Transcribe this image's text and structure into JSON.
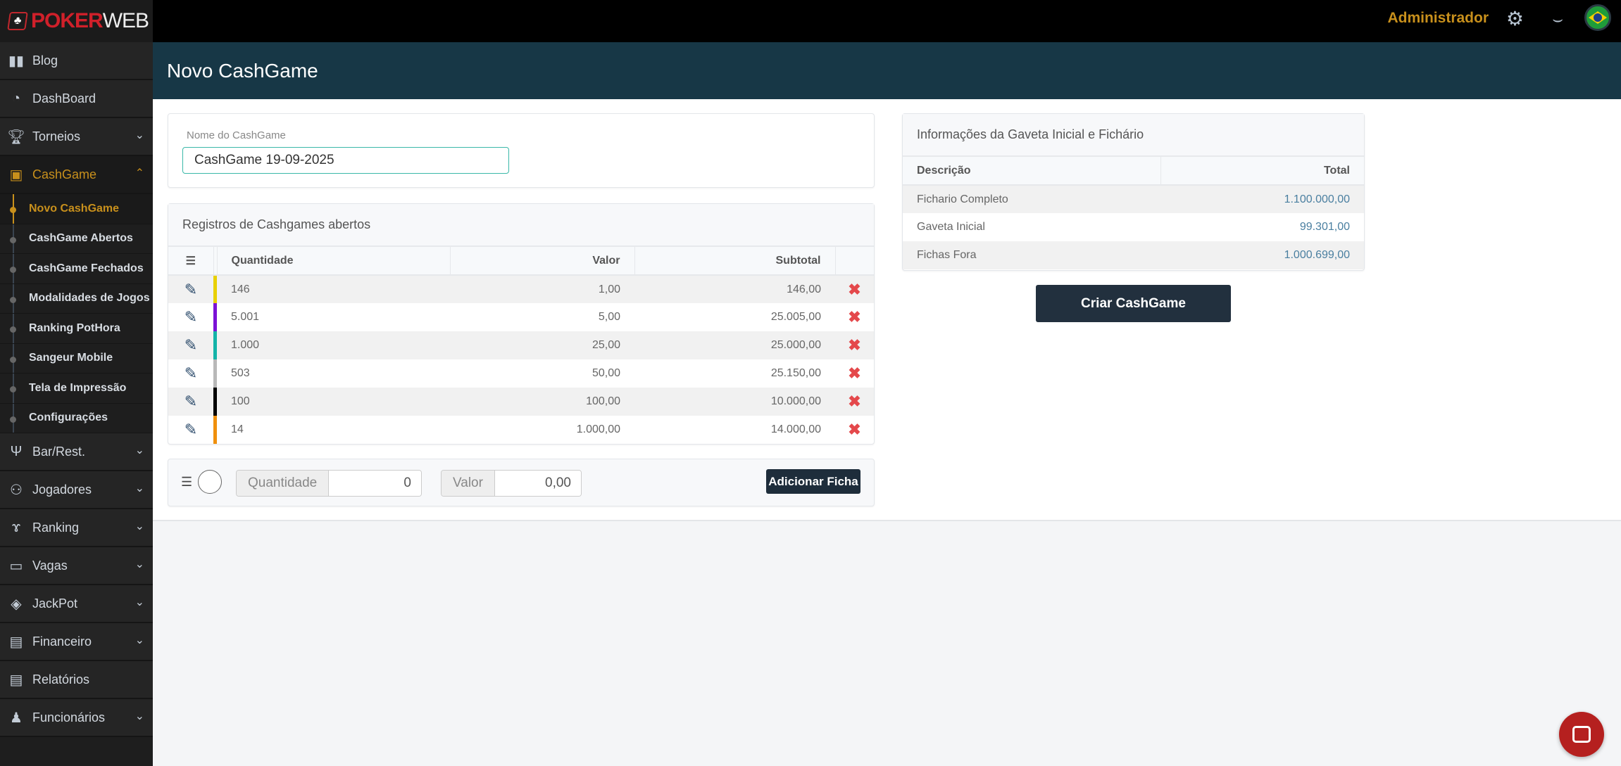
{
  "brand": {
    "text_red": "POKER",
    "text_white": "WEB"
  },
  "topbar": {
    "user": "Administrador",
    "icons": [
      "gears-icon",
      "mustache-icon",
      "brazil-flag-icon"
    ]
  },
  "sidebar": {
    "items": [
      {
        "label": "Blog",
        "icon": "book-icon"
      },
      {
        "label": "DashBoard",
        "icon": "pie-chart-icon"
      },
      {
        "label": "Torneios",
        "icon": "trophy-icon"
      },
      {
        "label": "CashGame",
        "icon": "money-icon"
      }
    ],
    "cashgame_sub": [
      "Novo CashGame",
      "CashGame Abertos",
      "CashGame Fechados",
      "Modalidades de Jogos",
      "Ranking PotHora",
      "Sangeur Mobile",
      "Tela de Impressão",
      "Configurações"
    ],
    "items2": [
      {
        "label": "Bar/Rest.",
        "icon": "utensils-icon"
      },
      {
        "label": "Jogadores",
        "icon": "users-icon"
      },
      {
        "label": "Ranking",
        "icon": "medal-icon"
      },
      {
        "label": "Vagas",
        "icon": "ticket-icon"
      },
      {
        "label": "JackPot",
        "icon": "gem-icon"
      },
      {
        "label": "Financeiro",
        "icon": "invoice-icon"
      },
      {
        "label": "Relatórios",
        "icon": "file-icon"
      },
      {
        "label": "Funcionários",
        "icon": "user-lock-icon"
      }
    ]
  },
  "page": {
    "title": "Novo CashGame"
  },
  "form": {
    "name_label": "Nome do CashGame",
    "name_value": "CashGame 19-09-2025"
  },
  "records": {
    "title": "Registros de Cashgames abertos",
    "columns": [
      "Quantidade",
      "Valor",
      "Subtotal"
    ],
    "rows": [
      {
        "qty": "146",
        "valor": "1,00",
        "subtotal": "146,00",
        "color": "#e8d000"
      },
      {
        "qty": "5.001",
        "valor": "5,00",
        "subtotal": "25.005,00",
        "color": "#7b12d6"
      },
      {
        "qty": "1.000",
        "valor": "25,00",
        "subtotal": "25.000,00",
        "color": "#13b3a8"
      },
      {
        "qty": "503",
        "valor": "50,00",
        "subtotal": "25.150,00",
        "color": "#b8b8b8"
      },
      {
        "qty": "100",
        "valor": "100,00",
        "subtotal": "10.000,00",
        "color": "#000000"
      },
      {
        "qty": "14",
        "valor": "1.000,00",
        "subtotal": "14.000,00",
        "color": "#f0900c"
      }
    ]
  },
  "add": {
    "qty_label": "Quantidade",
    "qty_value": "0",
    "valor_label": "Valor",
    "valor_value": "0,00",
    "button": "Adicionar Ficha"
  },
  "info": {
    "title": "Informações da Gaveta Inicial e Fichário",
    "columns": [
      "Descrição",
      "Total"
    ],
    "rows": [
      {
        "desc": "Fichario Completo",
        "total": "1.100.000,00"
      },
      {
        "desc": "Gaveta Inicial",
        "total": "99.301,00"
      },
      {
        "desc": "Fichas Fora",
        "total": "1.000.699,00"
      }
    ],
    "button": "Criar CashGame"
  }
}
